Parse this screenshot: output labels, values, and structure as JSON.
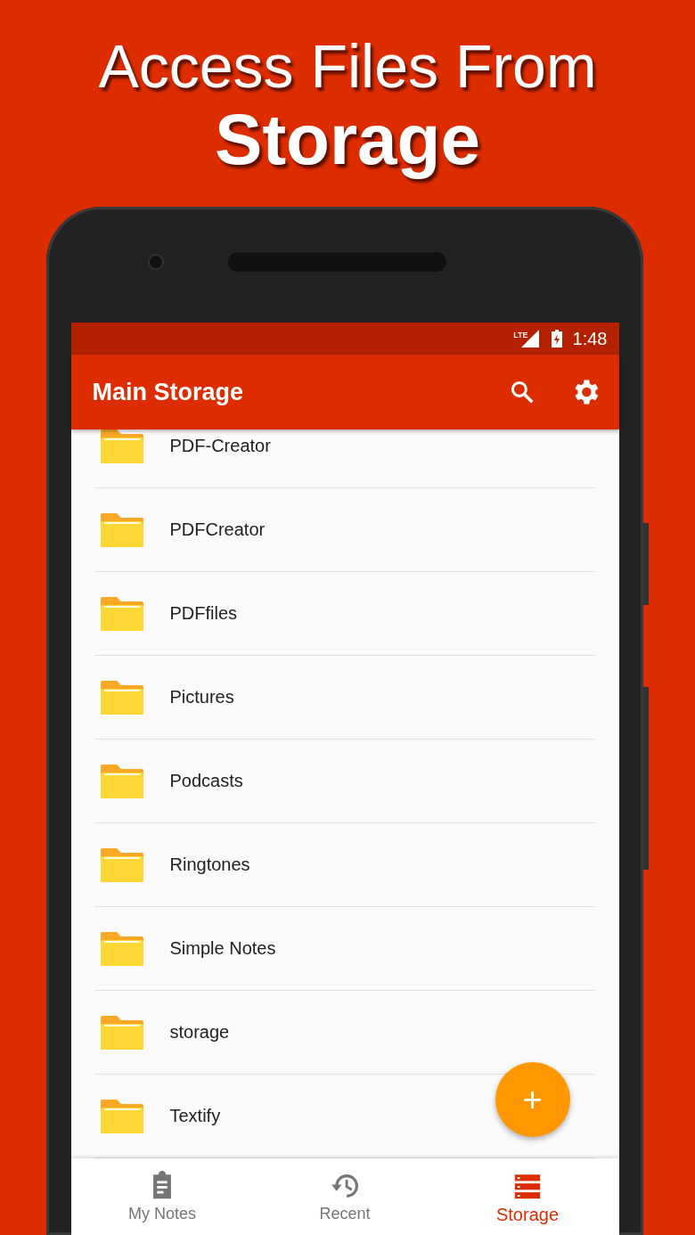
{
  "headline": {
    "line_1": "Access Files From",
    "line_2": "Storage"
  },
  "status_bar": {
    "network": "LTE",
    "time": "1:48"
  },
  "app_bar": {
    "title": "Main Storage"
  },
  "folders": [
    {
      "name": "PDF-Creator"
    },
    {
      "name": "PDFCreator"
    },
    {
      "name": "PDFfiles"
    },
    {
      "name": "Pictures"
    },
    {
      "name": "Podcasts"
    },
    {
      "name": "Ringtones"
    },
    {
      "name": "Simple Notes"
    },
    {
      "name": "storage"
    },
    {
      "name": "Textify"
    }
  ],
  "fab": {
    "label": "+"
  },
  "bottom_nav": [
    {
      "label": "My Notes",
      "kind": "notes",
      "selected": false
    },
    {
      "label": "Recent",
      "kind": "recent",
      "selected": false
    },
    {
      "label": "Storage",
      "kind": "storage",
      "selected": true
    }
  ]
}
